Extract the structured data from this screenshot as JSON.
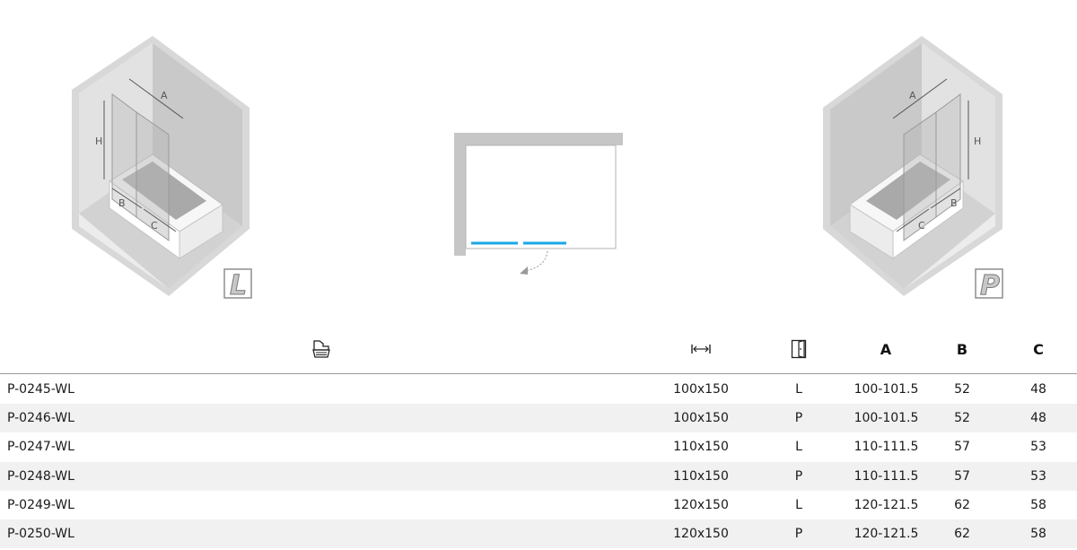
{
  "figures": {
    "left": {
      "dims": {
        "a": "A",
        "h": "H",
        "b": "B",
        "c": "C"
      },
      "badge": "L"
    },
    "right": {
      "dims": {
        "a": "A",
        "h": "H",
        "b": "B",
        "c": "C"
      },
      "badge": "P"
    },
    "accent": "#1aa7e6"
  },
  "table": {
    "header": {
      "model_icon": "bathtub-icon",
      "width_icon": "width-arrows-icon",
      "side_icon": "door-icon",
      "a": "A",
      "b": "B",
      "c": "C"
    },
    "rows": [
      {
        "code": "P-0245-WL",
        "size": "100x150",
        "side": "L",
        "a": "100-101.5",
        "b": "52",
        "c": "48"
      },
      {
        "code": "P-0246-WL",
        "size": "100x150",
        "side": "P",
        "a": "100-101.5",
        "b": "52",
        "c": "48"
      },
      {
        "code": "P-0247-WL",
        "size": "110x150",
        "side": "L",
        "a": "110-111.5",
        "b": "57",
        "c": "53"
      },
      {
        "code": "P-0248-WL",
        "size": "110x150",
        "side": "P",
        "a": "110-111.5",
        "b": "57",
        "c": "53"
      },
      {
        "code": "P-0249-WL",
        "size": "120x150",
        "side": "L",
        "a": "120-121.5",
        "b": "62",
        "c": "58"
      },
      {
        "code": "P-0250-WL",
        "size": "120x150",
        "side": "P",
        "a": "120-121.5",
        "b": "62",
        "c": "58"
      }
    ]
  }
}
